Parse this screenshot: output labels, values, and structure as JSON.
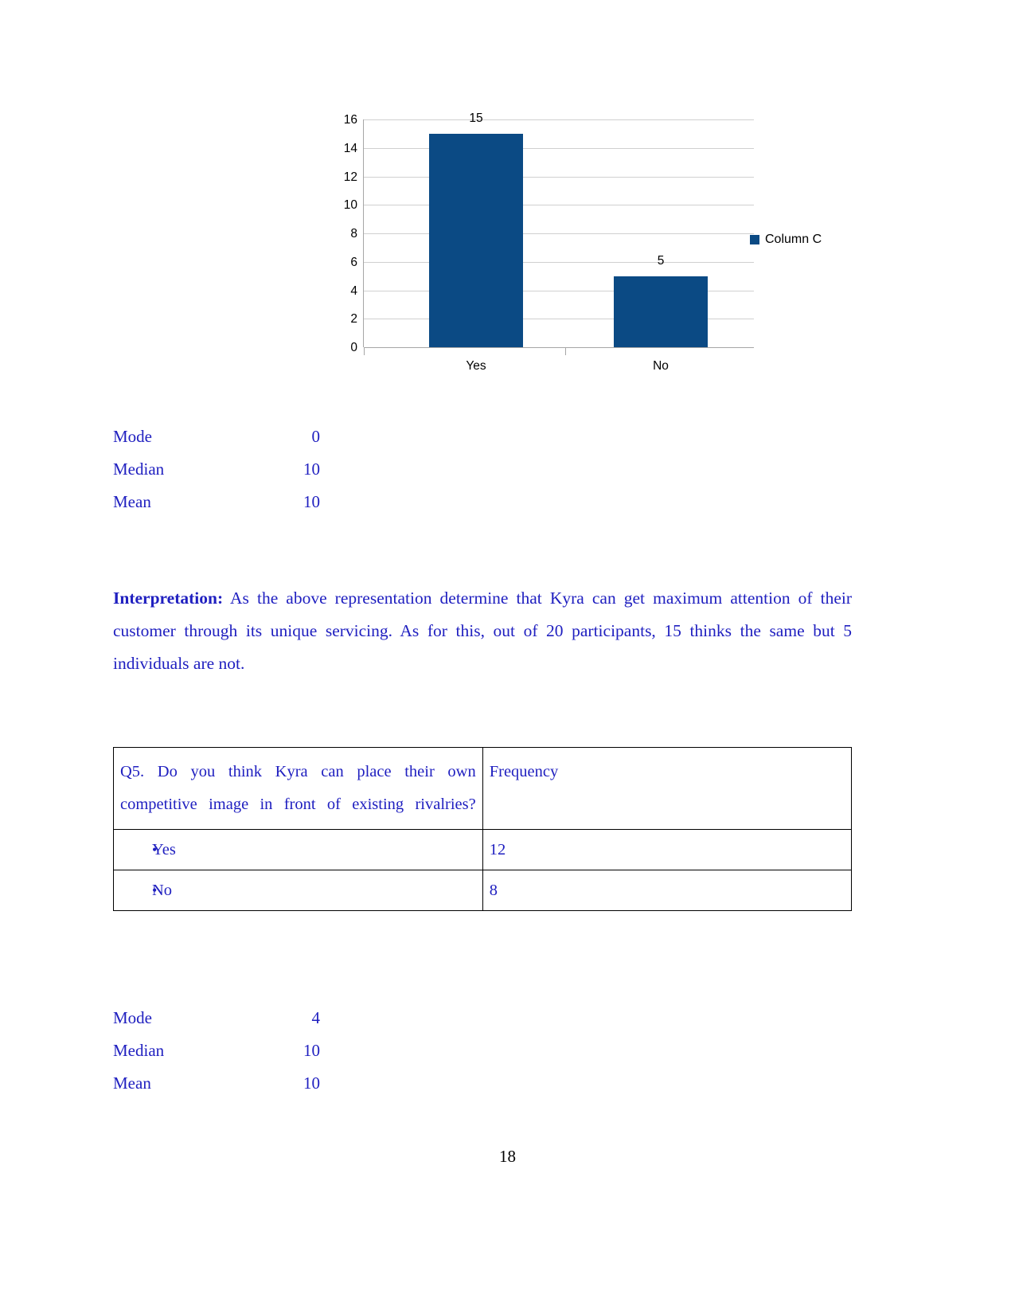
{
  "chart_data": {
    "type": "bar",
    "categories": [
      "Yes",
      "No"
    ],
    "values": [
      15,
      5
    ],
    "data_labels": [
      "15",
      "5"
    ],
    "title": "",
    "xlabel": "",
    "ylabel": "",
    "ylim": [
      0,
      16
    ],
    "ytick_labels": [
      "0",
      "2",
      "4",
      "6",
      "8",
      "10",
      "12",
      "14",
      "16"
    ],
    "yticks": [
      0,
      2,
      4,
      6,
      8,
      10,
      12,
      14,
      16
    ],
    "grid": true,
    "legend": {
      "position": "right",
      "entries": [
        {
          "label": "Column C",
          "color": "#0b4a84"
        }
      ]
    },
    "series": [
      {
        "name": "Column C",
        "values": [
          15,
          5
        ],
        "color": "#0b4a84"
      }
    ]
  },
  "stats_top": {
    "rows": [
      {
        "label": "Mode",
        "value": "0"
      },
      {
        "label": "Median",
        "value": "10"
      },
      {
        "label": "Mean",
        "value": "10"
      }
    ]
  },
  "interpretation": {
    "heading": "Interpretation:",
    "body": " As the above representation determine that Kyra can get maximum attention of their customer through its unique servicing. As for this, out of 20 participants, 15 thinks the same but 5 individuals are not."
  },
  "question_table": {
    "header": {
      "question": "Q5. Do you think Kyra can place their own competitive image in front of existing rivalries?",
      "frequency": "Frequency"
    },
    "rows": [
      {
        "option": "Yes",
        "frequency": "12"
      },
      {
        "option": "No",
        "frequency": "8"
      }
    ]
  },
  "stats_bottom": {
    "rows": [
      {
        "label": "Mode",
        "value": "4"
      },
      {
        "label": "Median",
        "value": "10"
      },
      {
        "label": "Mean",
        "value": "10"
      }
    ]
  },
  "footer": {
    "page_number": "18"
  }
}
